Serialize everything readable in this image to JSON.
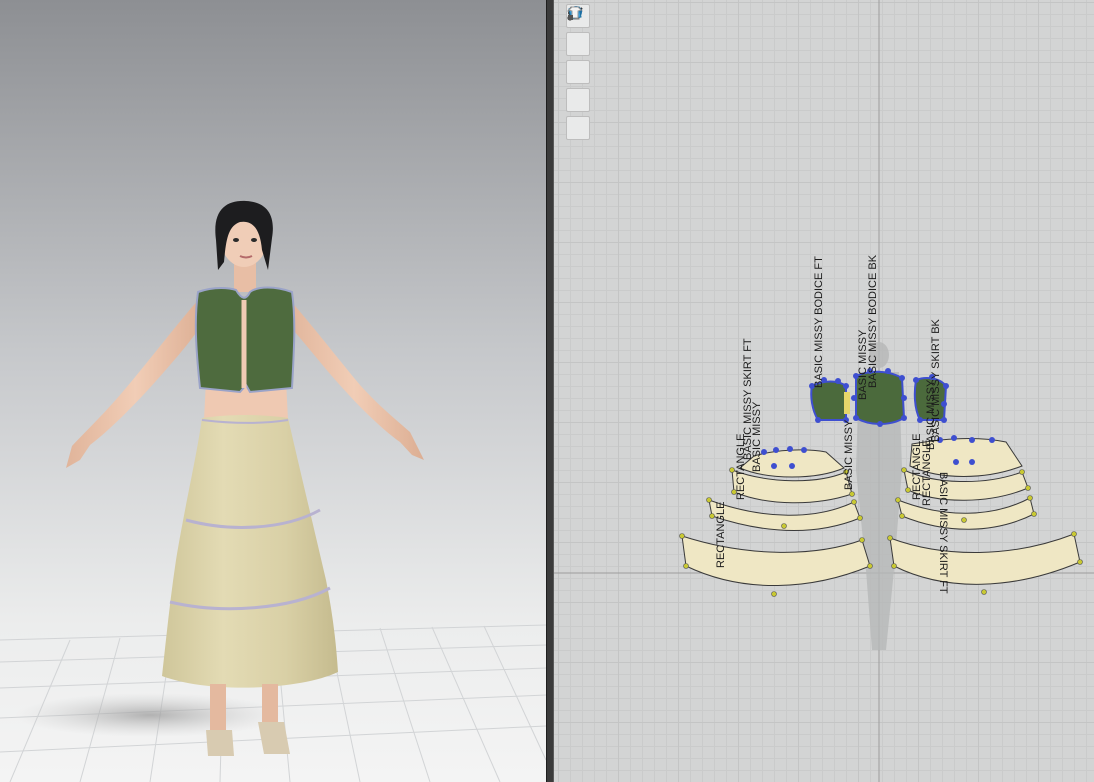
{
  "viewport_3d": {
    "avatar": "female-avatar",
    "garment": "green-vest-and-tiered-skirt"
  },
  "viewport_2d": {
    "toolbar": [
      {
        "name": "edit-pattern-icon"
      },
      {
        "name": "garment-icon"
      },
      {
        "name": "info-icon"
      },
      {
        "name": "texture-icon"
      },
      {
        "name": "lock-garment-icon"
      }
    ],
    "pattern_labels": {
      "bodice_ft": "BASIC MISSY BODICE FT",
      "bodice_bk": "BASIC MISSY BODICE BK",
      "skirt_ft": "BASIC MISSY SKIRT FT",
      "skirt_bk": "BASIC MISSY SKIRT BK",
      "rect_1": "RECTANGLE",
      "rect_2": "RECTANGLE",
      "rect_3": "RECTANGLE",
      "rect_4": "RECTANGLE",
      "overlap_1": "BASIC MISSY",
      "overlap_2": "BASIC MISSY",
      "overlap_3": "BASIC MISSY SKIRT FT",
      "overlap_4": "BASIC MISSY",
      "overlap_5": "BASIC MISSY"
    }
  },
  "colors": {
    "bodice": "#4b6a3c",
    "skirt_fabric": "#efe7c4",
    "point": "#3e4fd0",
    "canvas": "#d3d4d4"
  }
}
